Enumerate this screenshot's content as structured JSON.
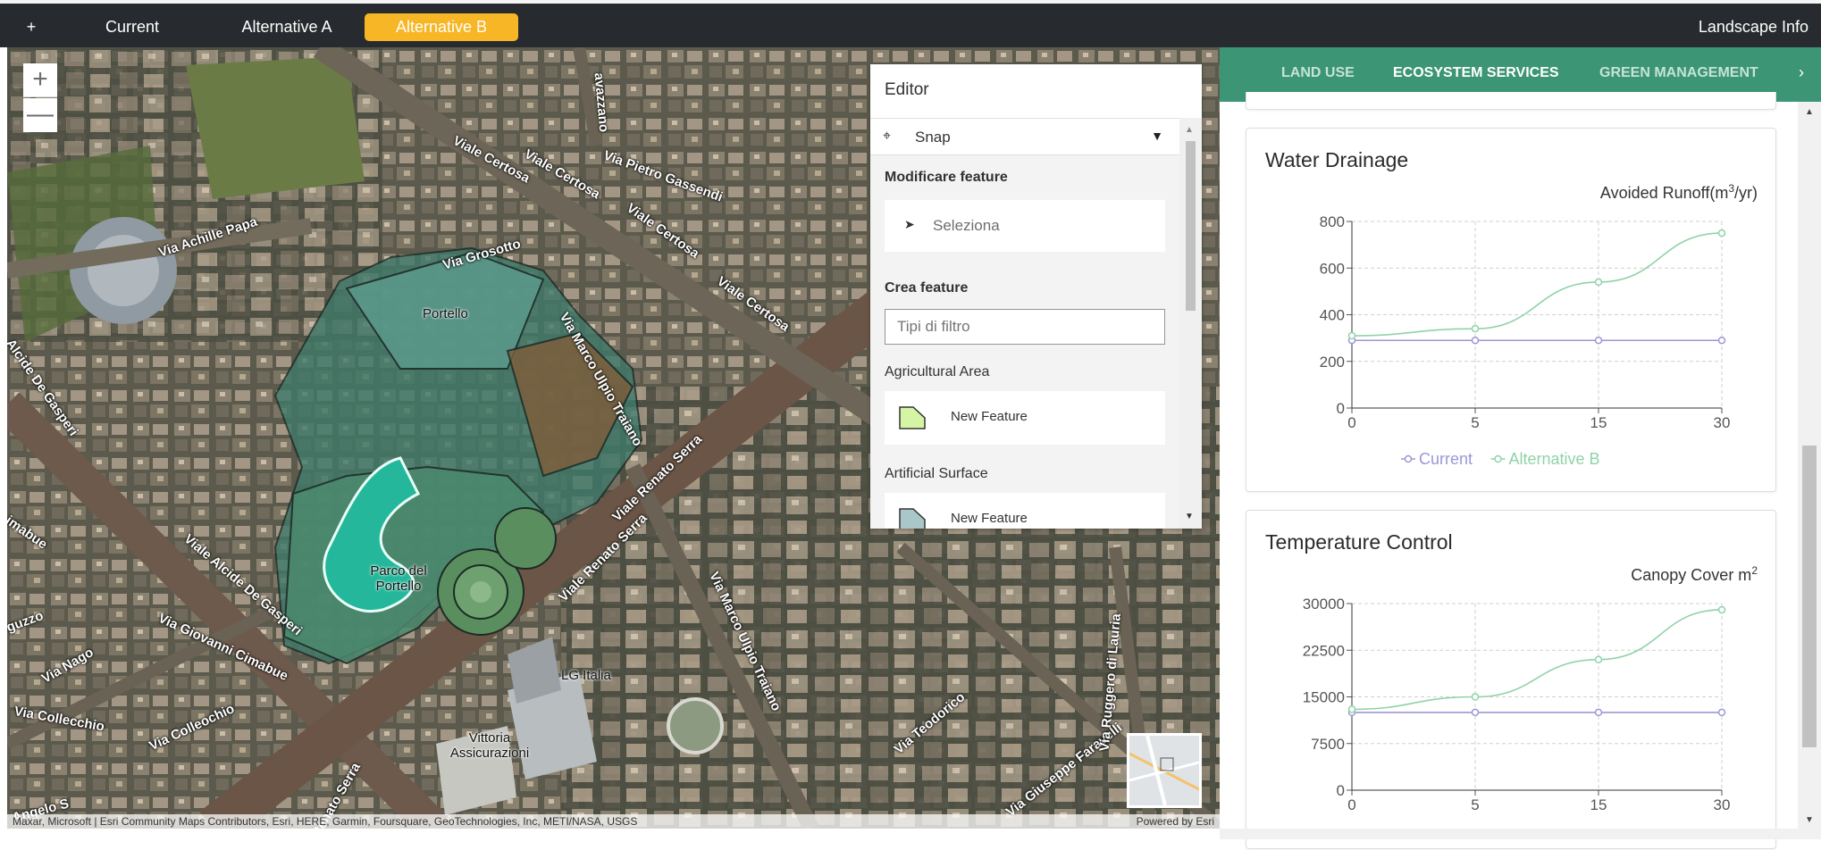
{
  "topbar": {
    "add_label": "+",
    "tabs": [
      {
        "label": "Current"
      },
      {
        "label": "Alternative A"
      },
      {
        "label": "Alternative B",
        "active": true
      }
    ],
    "info_label": "Landscape Info",
    "accent_color": "#f7b625"
  },
  "map": {
    "zoom_in": "+",
    "zoom_out": "—",
    "streets": [
      "Viale Certosa",
      "Viale Certosa",
      "Viale Certosa",
      "Viale Certosa",
      "Via Pietro Gassendi",
      "Via Achille Papa",
      "Via Grosotto",
      "Via Marco Ulpio Traiano",
      "Via Marco Ulpio Traiano",
      "Viale Renato Serra",
      "Viale Renato Serra",
      "Viale Alcide De Gasperi",
      "Via Giovanni Cimabue",
      "Via Nago",
      "Via Collecchio",
      "Via Colleochio",
      "Via Teodorico",
      "Via Giuseppe Faravelli",
      "Via Ruggero di Lauria",
      "Renato Serra",
      "Alcide De Gasperi",
      "imabue",
      "guzzo",
      "Angelo S",
      "avazzano"
    ],
    "places": [
      "Portello",
      "Parco del Portello",
      "LG Italia",
      "Vittoria Assicurazioni"
    ],
    "attribution": "Maxar, Microsoft | Esri Community Maps Contributors, Esri, HERE, Garmin, Foursquare, GeoTechnologies, Inc, METI/NASA, USGS",
    "powered_by": "Powered by Esri"
  },
  "editor": {
    "title": "Editor",
    "snap_label": "Snap",
    "modify_heading": "Modificare feature",
    "select_label": "Seleziona",
    "create_heading": "Crea feature",
    "filter_placeholder": "Tipi di filtro",
    "layers": [
      {
        "name": "Agricultural Area",
        "item_label": "New Feature",
        "color": "#d5f5a5"
      },
      {
        "name": "Artificial Surface",
        "item_label": "New Feature",
        "color": "#a9c6c8"
      }
    ]
  },
  "panel": {
    "tabs": [
      "LAND USE",
      "ECOSYSTEM SERVICES",
      "GREEN MANAGEMENT"
    ],
    "active_tab": "ECOSYSTEM SERVICES",
    "tab_color": "#3c9575",
    "underline_color": "#8b3fa8",
    "cards": [
      {
        "title": "Water Drainage",
        "subtitle_prefix": "Avoided Runoff(m",
        "subtitle_sup": "3",
        "subtitle_suffix": "/yr)"
      },
      {
        "title": "Temperature Control",
        "subtitle_prefix": "Canopy Cover m",
        "subtitle_sup": "2",
        "subtitle_suffix": ""
      }
    ]
  },
  "chart_data": [
    {
      "type": "line",
      "title": "Water Drainage",
      "ylabel": "Avoided Runoff(m3/yr)",
      "x": [
        0,
        5,
        15,
        30
      ],
      "xticks": [
        "0",
        "5",
        "15",
        "30"
      ],
      "yticks": [
        "0",
        "200",
        "400",
        "600",
        "800"
      ],
      "ylim": [
        0,
        800
      ],
      "grid": true,
      "legend": "bottom",
      "series": [
        {
          "name": "Current",
          "color": "#9b97d6",
          "values": [
            290,
            290,
            290,
            290
          ]
        },
        {
          "name": "Alternative B",
          "color": "#8fd3a8",
          "values": [
            310,
            340,
            540,
            750
          ]
        }
      ]
    },
    {
      "type": "line",
      "title": "Temperature Control",
      "ylabel": "Canopy Cover m2",
      "x": [
        0,
        5,
        15,
        30
      ],
      "xticks": [
        "0",
        "5",
        "15",
        "30"
      ],
      "yticks": [
        "0",
        "7500",
        "15000",
        "22500",
        "30000"
      ],
      "ylim": [
        0,
        30000
      ],
      "grid": true,
      "series": [
        {
          "name": "Current",
          "color": "#9b97d6",
          "values": [
            12500,
            12500,
            12500,
            12500
          ]
        },
        {
          "name": "Alternative B",
          "color": "#8fd3a8",
          "values": [
            13000,
            15000,
            21000,
            29000
          ]
        }
      ]
    }
  ]
}
